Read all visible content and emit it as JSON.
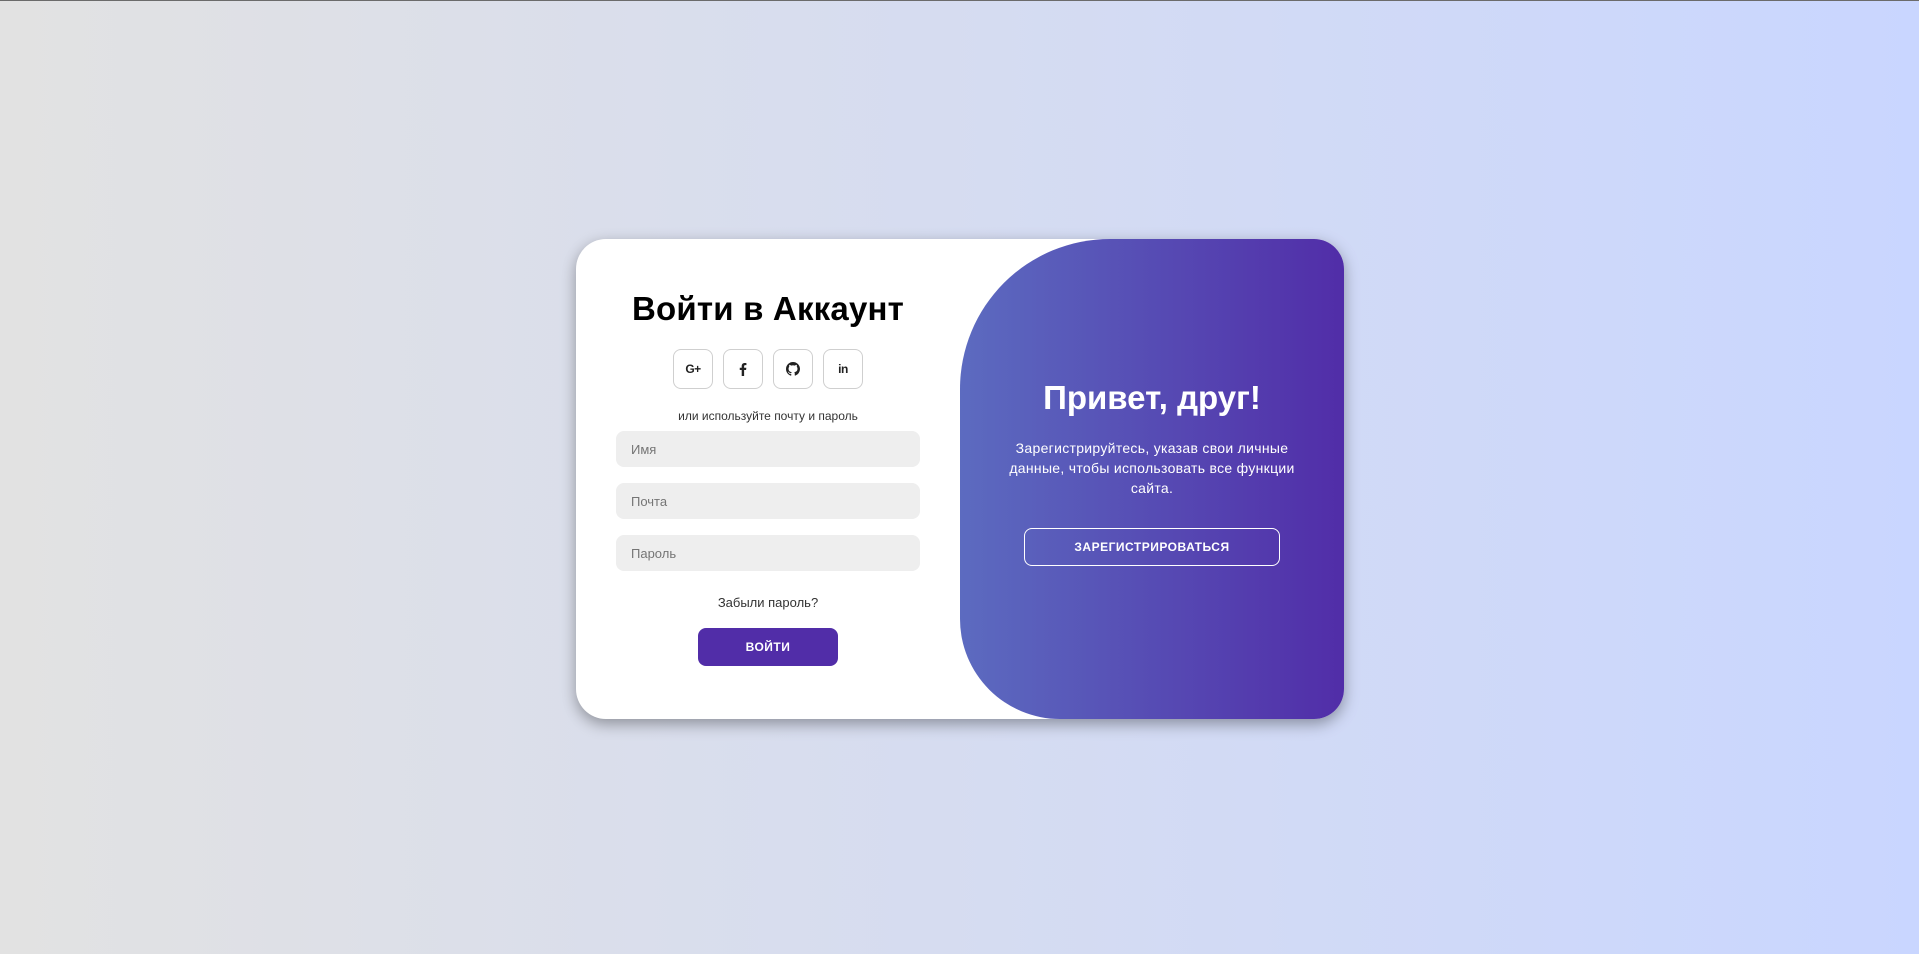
{
  "login": {
    "title": "Войти в Аккаунт",
    "social": [
      {
        "name": "google-plus-icon",
        "label": "G+"
      },
      {
        "name": "facebook-icon",
        "label": "f"
      },
      {
        "name": "github-icon",
        "label": ""
      },
      {
        "name": "linkedin-icon",
        "label": "in"
      }
    ],
    "hint": "или используйте почту и пароль",
    "fields": {
      "name_placeholder": "Имя",
      "email_placeholder": "Почта",
      "password_placeholder": "Пароль"
    },
    "forgot": "Забыли пароль?",
    "submit": "ВОЙТИ"
  },
  "toggle": {
    "title": "Привет, друг!",
    "text": "Зарегистрируйтесь, указав свои личные данные, чтобы использовать все функции сайта.",
    "button": "ЗАРЕГИСТРИРОВАТЬСЯ"
  },
  "colors": {
    "accent": "#512da8",
    "accent_light": "#5c6bc0",
    "input_bg": "#eeeeee",
    "page_bg_start": "#e2e2e2",
    "page_bg_end": "#c9d6ff"
  }
}
